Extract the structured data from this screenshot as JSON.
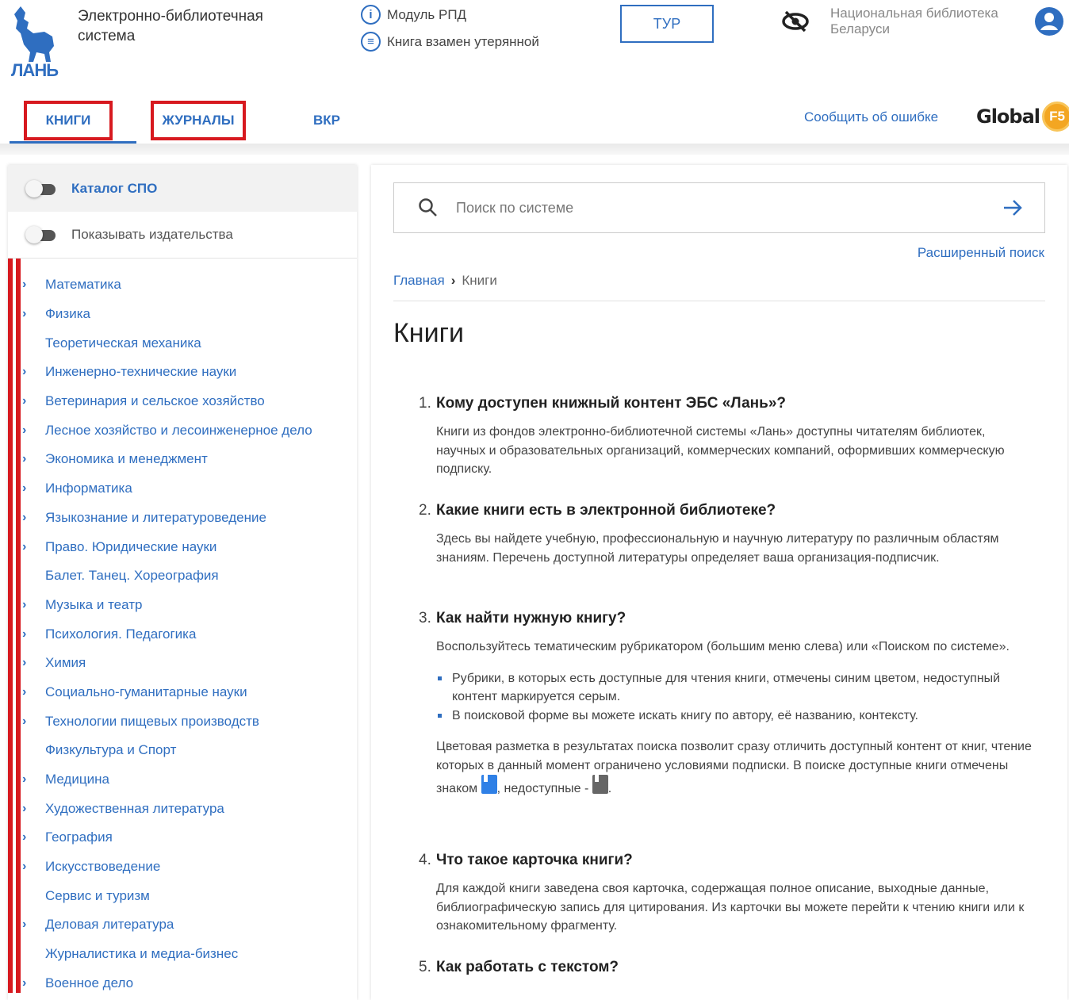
{
  "header": {
    "logo_text": "ЛАНЬ",
    "system_title": "Электронно-библиотечная система",
    "module_rpd": "Модуль РПД",
    "book_replace": "Книга взамен утерянной",
    "tour_label": "ТУР",
    "library_name": "Национальная библиотека Беларуси",
    "brand_color": "#2f6ec0"
  },
  "tabs": {
    "books": "КНИГИ",
    "journals": "ЖУРНАЛЫ",
    "vkr": "ВКР",
    "report_error": "Сообщить об ошибке",
    "global_text": "Global",
    "global_badge": "F5"
  },
  "sidebar": {
    "toggle_catalog": "Каталог СПО",
    "toggle_publishers": "Показывать издательства",
    "categories": [
      {
        "label": "Математика",
        "chevron": true
      },
      {
        "label": "Физика",
        "chevron": true
      },
      {
        "label": "Теоретическая механика",
        "chevron": false
      },
      {
        "label": "Инженерно-технические науки",
        "chevron": true
      },
      {
        "label": "Ветеринария и сельское хозяйство",
        "chevron": true
      },
      {
        "label": "Лесное хозяйство и лесоинженерное дело",
        "chevron": true
      },
      {
        "label": "Экономика и менеджмент",
        "chevron": true
      },
      {
        "label": "Информатика",
        "chevron": true
      },
      {
        "label": "Языкознание и литературоведение",
        "chevron": true
      },
      {
        "label": "Право. Юридические науки",
        "chevron": true
      },
      {
        "label": "Балет. Танец. Хореография",
        "chevron": false
      },
      {
        "label": "Музыка и театр",
        "chevron": true
      },
      {
        "label": "Психология. Педагогика",
        "chevron": true
      },
      {
        "label": "Химия",
        "chevron": true
      },
      {
        "label": "Социально-гуманитарные науки",
        "chevron": true
      },
      {
        "label": "Технологии пищевых производств",
        "chevron": true
      },
      {
        "label": "Физкультура и Спорт",
        "chevron": false
      },
      {
        "label": "Медицина",
        "chevron": true
      },
      {
        "label": "Художественная литература",
        "chevron": true
      },
      {
        "label": "География",
        "chevron": true
      },
      {
        "label": "Искусствоведение",
        "chevron": true
      },
      {
        "label": "Сервис и туризм",
        "chevron": false
      },
      {
        "label": "Деловая литература",
        "chevron": true
      },
      {
        "label": "Журналистика и медиа-бизнес",
        "chevron": false
      },
      {
        "label": "Военное дело",
        "chevron": true
      }
    ]
  },
  "main": {
    "search_placeholder": "Поиск по системе",
    "advanced_search": "Расширенный поиск",
    "breadcrumb_home": "Главная",
    "breadcrumb_current": "Книги",
    "page_title": "Книги",
    "faq": [
      {
        "num": "1.",
        "q": "Кому доступен книжный контент ЭБС «Лань»?",
        "a": "Книги из фондов электронно-библиотечной системы «Лань» доступны читателям библиотек, научных и образовательных организаций, коммерческих компаний, оформивших коммерческую подписку."
      },
      {
        "num": "2.",
        "q": "Какие книги есть в электронной библиотеке?",
        "a": "Здесь вы найдете учебную, профессиональную и научную литературу по различным областям знаниям. Перечень доступной литературы определяет ваша организация-подписчик."
      },
      {
        "num": "3.",
        "q": "Как найти нужную книгу?",
        "a": "Воспользуйтесь тематическим рубрикатором (большим меню слева) или «Поиском по системе».",
        "bullets": [
          "Рубрики, в которых есть доступные для чтения книги, отмечены синим цветом, недоступный контент маркируется серым.",
          "В поисковой форме вы можете искать книгу по автору, её названию, контексту."
        ],
        "note_before": "Цветовая разметка в результатах поиска позволит сразу отличить доступный контент от книг, чтение которых в данный момент ограничено условиями подписки. В поиске доступные книги отмечены знаком",
        "note_mid": ", недоступные -",
        "note_end": "."
      },
      {
        "num": "4.",
        "q": "Что такое карточка книги?",
        "a": "Для каждой книги заведена своя карточка, содержащая полное описание, выходные данные, библиографическую запись для цитирования. Из карточки вы можете перейти к чтению книги или к ознакомительному фрагменту."
      },
      {
        "num": "5.",
        "q": "Как работать с текстом?"
      }
    ]
  }
}
